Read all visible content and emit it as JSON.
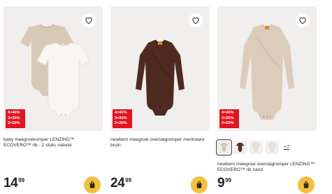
{
  "products": [
    {
      "title": "baby meegroeiromper LENZING™ ECOVERO™ rib - 2 stuks naturel",
      "promo": [
        "4=40%",
        "3=30%",
        "2=20%"
      ],
      "price_whole": "14",
      "price_cents": "99",
      "icons": {
        "favorite": "heart-icon",
        "cart": "shopping-bag-icon"
      }
    },
    {
      "title": "newborn meegroei overslagromper merinowol bruin",
      "promo": [
        "4=40%",
        "3=30%",
        "2=20%"
      ],
      "price_whole": "24",
      "price_cents": "99",
      "icons": {
        "favorite": "heart-icon",
        "cart": "shopping-bag-icon"
      }
    },
    {
      "title": "newborn meegroei overslagromper LENZING™ ECOVERO™ rib zand",
      "promo": [
        "4=40%",
        "3=30%",
        "2=20%"
      ],
      "price_whole": "9",
      "price_cents": "99",
      "more_colors": "+7",
      "swatch_colors": [
        "#d9cab8",
        "#5a2f24",
        "#e8e0d4",
        "#e6dfd6"
      ],
      "icons": {
        "favorite": "heart-icon",
        "cart": "shopping-bag-icon"
      }
    }
  ],
  "colors": {
    "promo": "#e3141f",
    "cart": "#f4bf3b",
    "image_bg": "#f1efed"
  }
}
